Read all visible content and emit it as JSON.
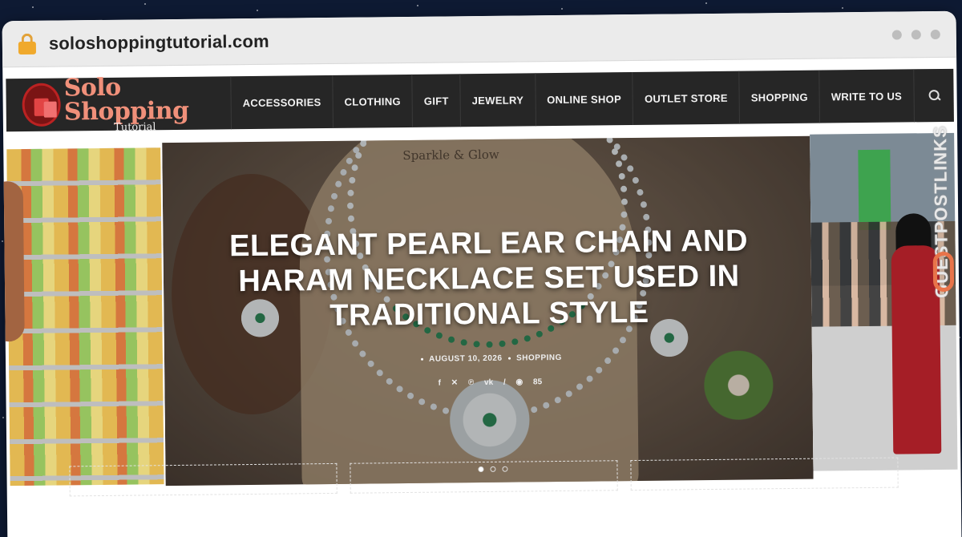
{
  "browser": {
    "url": "soloshoppingtutorial.com"
  },
  "site": {
    "logo_main": "Solo Shopping",
    "logo_sub": "Tutorial",
    "nav": [
      "ACCESSORIES",
      "CLOTHING",
      "GIFT",
      "JEWELRY",
      "ONLINE SHOP",
      "OUTLET STORE",
      "SHOPPING",
      "WRITE TO US"
    ]
  },
  "hero": {
    "brand_mark": "Sparkle & Glow",
    "title": "ELEGANT PEARL EAR CHAIN AND HARAM NECKLACE SET USED IN TRADITIONAL STYLE",
    "date": "AUGUST 10, 2026",
    "category": "SHOPPING",
    "views": "85"
  },
  "watermark": "GUESTPOSTLINKS",
  "colors": {
    "nav_bg": "#262626",
    "logo_accent": "#f0907a",
    "lock": "#f0a92c"
  }
}
